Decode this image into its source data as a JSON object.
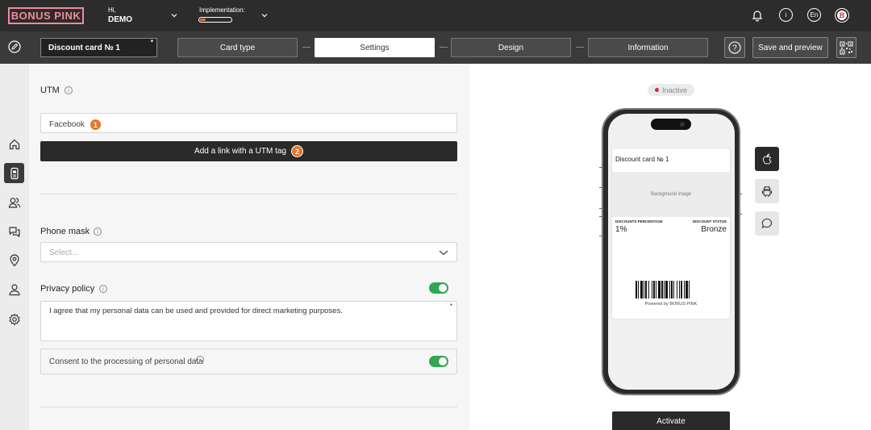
{
  "header": {
    "logo": "BONUS PINK",
    "greeting": "Hi,",
    "user_name": "DEMO",
    "implementation_label": "Implementation:",
    "implementation_progress": 0.18,
    "language": "En",
    "avatar_letter": "B"
  },
  "toolbar": {
    "card_name": "Discount card № 1",
    "required_mark": "*",
    "steps": [
      {
        "label": "Card type"
      },
      {
        "label": "Settings"
      },
      {
        "label": "Design"
      },
      {
        "label": "Information"
      }
    ],
    "active_step": "Settings",
    "save_label": "Save and preview"
  },
  "sidebar": {
    "items": [
      "home-icon",
      "card-icon",
      "clients-icon",
      "chat-icon",
      "location-icon",
      "user-icon",
      "gear-icon"
    ],
    "active": "card-icon"
  },
  "form": {
    "utm": {
      "label": "UTM",
      "value": "Facebook",
      "badge_1": "1",
      "add_button": "Add a link with a UTM tag",
      "badge_2": "2"
    },
    "phone_mask": {
      "label": "Phone mask",
      "placeholder": "Select..."
    },
    "privacy": {
      "label": "Privacy policy",
      "enabled": true,
      "text": "I agree that my personal data can be used and provided for direct marketing purposes.",
      "required_mark": "*",
      "consent_label": "Consent to the processing of personal data",
      "consent_enabled": true
    }
  },
  "preview": {
    "status": "Inactive",
    "card_title": "Discount card № 1",
    "background_label": "Background image",
    "field_left_label": "DISCOUNTS PERCENTAGE",
    "field_left_value": "1%",
    "field_right_label": "DISCOUNT STATUS",
    "field_right_value": "Bronze",
    "powered_by": "Powered by BONUS PINK",
    "activate_label": "Activate",
    "platforms": [
      "apple-icon",
      "android-icon",
      "message-icon"
    ]
  },
  "colors": {
    "brand": "#f08aa0",
    "accent": "#e8722c",
    "toggle_on": "#2fa84f",
    "dark": "#2c2c2c"
  }
}
